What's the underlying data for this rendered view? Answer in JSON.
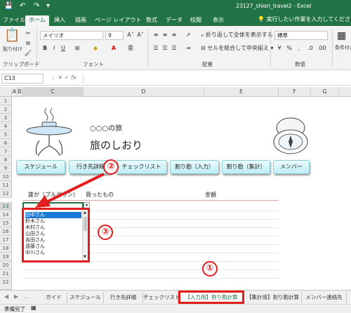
{
  "window": {
    "title": "23127_shiori_travel2  -  Excel"
  },
  "ribbon_tabs": [
    "ファイル",
    "ホーム",
    "挿入",
    "描画",
    "ページ レイアウト",
    "数式",
    "データ",
    "校閲",
    "表示"
  ],
  "tell_me": "実行したい作業を入力してください",
  "ribbon": {
    "paste": "貼り付け",
    "font_name": "メイリオ",
    "font_size": "9",
    "wrap_text": "折り返して全体を表示する",
    "merge_center": "セルを結合して中央揃え",
    "number_format": "標準",
    "conditional": "条件付き書式",
    "groups": {
      "clipboard": "クリップボード",
      "font": "フォント",
      "alignment": "配置",
      "number": "数値"
    }
  },
  "namebox": "C13",
  "columns": [
    "A",
    "B",
    "C",
    "D",
    "E",
    "F",
    "G"
  ],
  "rows": [
    "1",
    "2",
    "3",
    "4",
    "5",
    "6",
    "7",
    "8",
    "9",
    "10",
    "11",
    "12",
    "13",
    "14",
    "15",
    "16",
    "17",
    "18",
    "19",
    "20",
    "21",
    "22"
  ],
  "sheet": {
    "subtitle": "○○○の旅",
    "title": "旅のしおり",
    "nav_buttons": [
      "スケジュール",
      "行き先詳細",
      "チェックリスト",
      "割り勘（入力）",
      "割り勘（集計）",
      "メンバー"
    ],
    "header_who": "誰が（プルダウン）",
    "header_what": "買ったもの",
    "header_amount": "金額"
  },
  "dropdown_options": [
    "田中さん",
    "鈴木さん",
    "木村さん",
    "山田さん",
    "吉田さん",
    "遠藤さん",
    "中川さん"
  ],
  "callouts": [
    "①",
    "②",
    "③"
  ],
  "sheet_tabs": [
    "ガイド",
    "スケジュール",
    "行き先詳細",
    "チェックリスト",
    "【入力用】割り勘計算",
    "【集計用】割り勘計算",
    "メンバー連絡先"
  ],
  "status": "準備完了",
  "colors": {
    "excel_green": "#217346",
    "callout_red": "#e31c1c",
    "button_cyan": "#bfeef5"
  }
}
